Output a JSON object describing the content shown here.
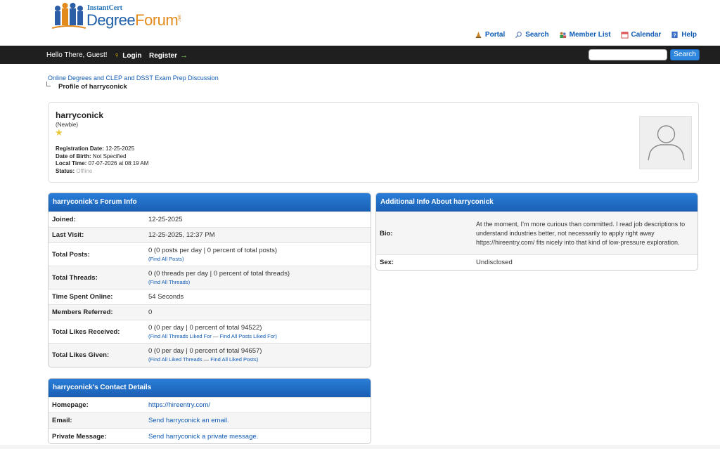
{
  "header": {
    "logo_small": "InstantCert",
    "logo_degree": "Degree",
    "logo_forum": "Forum",
    "logo_net": ".net",
    "links": [
      {
        "label": "Portal",
        "icon": "portal-icon"
      },
      {
        "label": "Search",
        "icon": "search-icon"
      },
      {
        "label": "Member List",
        "icon": "members-icon"
      },
      {
        "label": "Calendar",
        "icon": "calendar-icon"
      },
      {
        "label": "Help",
        "icon": "help-icon"
      }
    ]
  },
  "navbar": {
    "greeting": "Hello There, Guest!",
    "login": "Login",
    "register": "Register",
    "search_value": "",
    "search_button": "Search"
  },
  "breadcrumb": {
    "root": "Online Degrees and CLEP and DSST Exam Prep Discussion",
    "current": "Profile of harryconick"
  },
  "profile": {
    "username": "harryconick",
    "usertitle": "(Newbie)",
    "reg_label": "Registration Date:",
    "reg_value": "12-25-2025",
    "dob_label": "Date of Birth:",
    "dob_value": "Not Specified",
    "lt_label": "Local Time:",
    "lt_value": "07-07-2026 at 08:19 AM",
    "status_label": "Status:",
    "status_value": "Offline"
  },
  "forum_info": {
    "title": "harryconick's Forum Info",
    "rows": [
      {
        "label": "Joined:",
        "value": "12-25-2025"
      },
      {
        "label": "Last Visit:",
        "value": "12-25-2025, 12:37 PM"
      },
      {
        "label": "Total Posts:",
        "value": "0 (0 posts per day | 0 percent of total posts)",
        "link1": "Find All Posts"
      },
      {
        "label": "Total Threads:",
        "value": "0 (0 threads per day | 0 percent of total threads)",
        "link1": "Find All Threads"
      },
      {
        "label": "Time Spent Online:",
        "value": "54 Seconds"
      },
      {
        "label": "Members Referred:",
        "value": "0"
      },
      {
        "label": "Total Likes Received:",
        "value": "0 (0 per day | 0 percent of total 94522)",
        "link1": "Find All Threads Liked For",
        "sep": "—",
        "link2": "Find All Posts Liked For"
      },
      {
        "label": "Total Likes Given:",
        "value": "0 (0 per day | 0 percent of total 94657)",
        "link1": "Find All Liked Threads",
        "sep": "—",
        "link2": "Find All Liked Posts"
      }
    ]
  },
  "additional_info": {
    "title": "Additional Info About harryconick",
    "bio_label": "Bio:",
    "bio_value": "At the moment, I’m more curious than committed. I read job descriptions to understand industries better, not necessarily to apply right away https://hireentry.com/ fits nicely into that kind of low-pressure exploration.",
    "sex_label": "Sex:",
    "sex_value": "Undisclosed"
  },
  "contact": {
    "title": "harryconick's Contact Details",
    "homepage_label": "Homepage:",
    "homepage_value": "https://hireentry.com/",
    "email_label": "Email:",
    "email_value": "Send harryconick an email.",
    "pm_label": "Private Message:",
    "pm_value": "Send harryconick a private message."
  }
}
